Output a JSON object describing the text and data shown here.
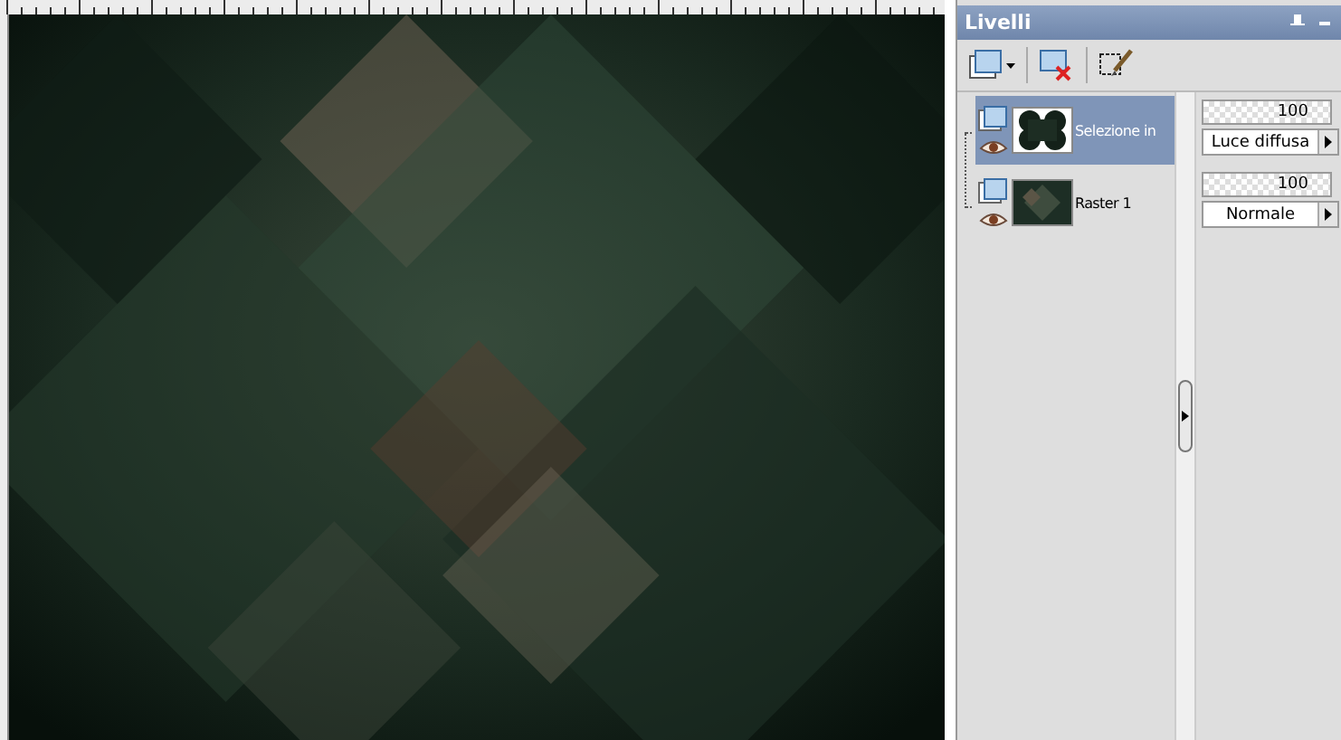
{
  "panel": {
    "title": "Livelli"
  },
  "layers": [
    {
      "name": "Selezione in",
      "opacity": "100",
      "blend_mode": "Luce diffusa",
      "selected": true,
      "kind": "mask"
    },
    {
      "name": "Raster 1",
      "opacity": "100",
      "blend_mode": "Normale",
      "selected": false,
      "kind": "raster"
    }
  ]
}
